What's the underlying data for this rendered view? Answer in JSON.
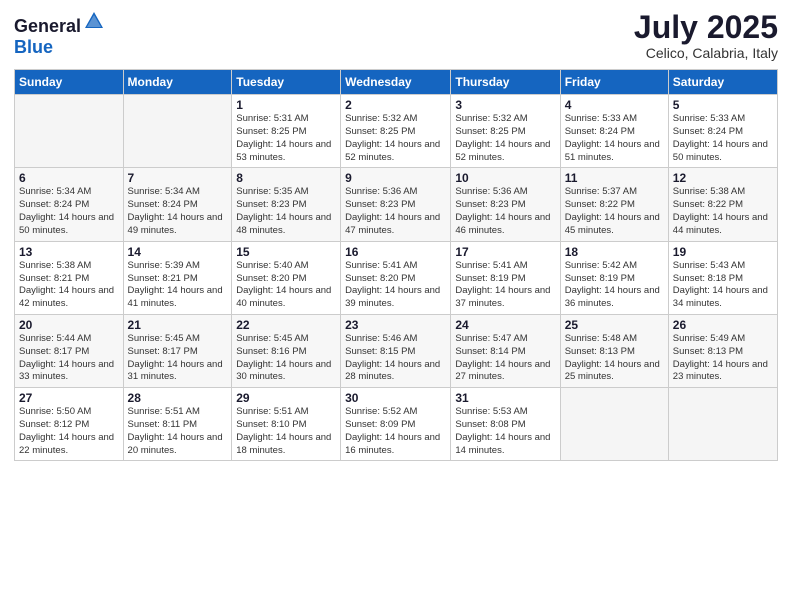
{
  "header": {
    "logo_general": "General",
    "logo_blue": "Blue",
    "month_year": "July 2025",
    "location": "Celico, Calabria, Italy"
  },
  "weekdays": [
    "Sunday",
    "Monday",
    "Tuesday",
    "Wednesday",
    "Thursday",
    "Friday",
    "Saturday"
  ],
  "weeks": [
    [
      {
        "day": "",
        "info": ""
      },
      {
        "day": "",
        "info": ""
      },
      {
        "day": "1",
        "info": "Sunrise: 5:31 AM\nSunset: 8:25 PM\nDaylight: 14 hours and 53 minutes."
      },
      {
        "day": "2",
        "info": "Sunrise: 5:32 AM\nSunset: 8:25 PM\nDaylight: 14 hours and 52 minutes."
      },
      {
        "day": "3",
        "info": "Sunrise: 5:32 AM\nSunset: 8:25 PM\nDaylight: 14 hours and 52 minutes."
      },
      {
        "day": "4",
        "info": "Sunrise: 5:33 AM\nSunset: 8:24 PM\nDaylight: 14 hours and 51 minutes."
      },
      {
        "day": "5",
        "info": "Sunrise: 5:33 AM\nSunset: 8:24 PM\nDaylight: 14 hours and 50 minutes."
      }
    ],
    [
      {
        "day": "6",
        "info": "Sunrise: 5:34 AM\nSunset: 8:24 PM\nDaylight: 14 hours and 50 minutes."
      },
      {
        "day": "7",
        "info": "Sunrise: 5:34 AM\nSunset: 8:24 PM\nDaylight: 14 hours and 49 minutes."
      },
      {
        "day": "8",
        "info": "Sunrise: 5:35 AM\nSunset: 8:23 PM\nDaylight: 14 hours and 48 minutes."
      },
      {
        "day": "9",
        "info": "Sunrise: 5:36 AM\nSunset: 8:23 PM\nDaylight: 14 hours and 47 minutes."
      },
      {
        "day": "10",
        "info": "Sunrise: 5:36 AM\nSunset: 8:23 PM\nDaylight: 14 hours and 46 minutes."
      },
      {
        "day": "11",
        "info": "Sunrise: 5:37 AM\nSunset: 8:22 PM\nDaylight: 14 hours and 45 minutes."
      },
      {
        "day": "12",
        "info": "Sunrise: 5:38 AM\nSunset: 8:22 PM\nDaylight: 14 hours and 44 minutes."
      }
    ],
    [
      {
        "day": "13",
        "info": "Sunrise: 5:38 AM\nSunset: 8:21 PM\nDaylight: 14 hours and 42 minutes."
      },
      {
        "day": "14",
        "info": "Sunrise: 5:39 AM\nSunset: 8:21 PM\nDaylight: 14 hours and 41 minutes."
      },
      {
        "day": "15",
        "info": "Sunrise: 5:40 AM\nSunset: 8:20 PM\nDaylight: 14 hours and 40 minutes."
      },
      {
        "day": "16",
        "info": "Sunrise: 5:41 AM\nSunset: 8:20 PM\nDaylight: 14 hours and 39 minutes."
      },
      {
        "day": "17",
        "info": "Sunrise: 5:41 AM\nSunset: 8:19 PM\nDaylight: 14 hours and 37 minutes."
      },
      {
        "day": "18",
        "info": "Sunrise: 5:42 AM\nSunset: 8:19 PM\nDaylight: 14 hours and 36 minutes."
      },
      {
        "day": "19",
        "info": "Sunrise: 5:43 AM\nSunset: 8:18 PM\nDaylight: 14 hours and 34 minutes."
      }
    ],
    [
      {
        "day": "20",
        "info": "Sunrise: 5:44 AM\nSunset: 8:17 PM\nDaylight: 14 hours and 33 minutes."
      },
      {
        "day": "21",
        "info": "Sunrise: 5:45 AM\nSunset: 8:17 PM\nDaylight: 14 hours and 31 minutes."
      },
      {
        "day": "22",
        "info": "Sunrise: 5:45 AM\nSunset: 8:16 PM\nDaylight: 14 hours and 30 minutes."
      },
      {
        "day": "23",
        "info": "Sunrise: 5:46 AM\nSunset: 8:15 PM\nDaylight: 14 hours and 28 minutes."
      },
      {
        "day": "24",
        "info": "Sunrise: 5:47 AM\nSunset: 8:14 PM\nDaylight: 14 hours and 27 minutes."
      },
      {
        "day": "25",
        "info": "Sunrise: 5:48 AM\nSunset: 8:13 PM\nDaylight: 14 hours and 25 minutes."
      },
      {
        "day": "26",
        "info": "Sunrise: 5:49 AM\nSunset: 8:13 PM\nDaylight: 14 hours and 23 minutes."
      }
    ],
    [
      {
        "day": "27",
        "info": "Sunrise: 5:50 AM\nSunset: 8:12 PM\nDaylight: 14 hours and 22 minutes."
      },
      {
        "day": "28",
        "info": "Sunrise: 5:51 AM\nSunset: 8:11 PM\nDaylight: 14 hours and 20 minutes."
      },
      {
        "day": "29",
        "info": "Sunrise: 5:51 AM\nSunset: 8:10 PM\nDaylight: 14 hours and 18 minutes."
      },
      {
        "day": "30",
        "info": "Sunrise: 5:52 AM\nSunset: 8:09 PM\nDaylight: 14 hours and 16 minutes."
      },
      {
        "day": "31",
        "info": "Sunrise: 5:53 AM\nSunset: 8:08 PM\nDaylight: 14 hours and 14 minutes."
      },
      {
        "day": "",
        "info": ""
      },
      {
        "day": "",
        "info": ""
      }
    ]
  ]
}
